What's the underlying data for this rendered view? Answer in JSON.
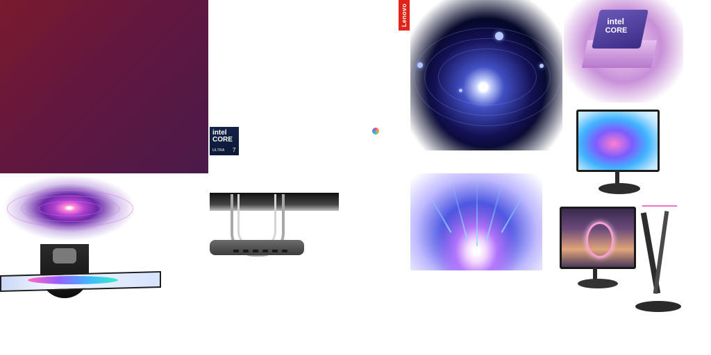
{
  "brand": {
    "logo_text": "Lenovo",
    "accent": "#e2231a"
  },
  "badges": {
    "intel": {
      "line1": "intel",
      "line2": "CORE",
      "line3": "ULTRA",
      "line4": "7"
    },
    "chip": {
      "line1": "intel",
      "line2": "CORE"
    }
  },
  "colors": {
    "hero_gradient": [
      "#7a1a2e",
      "#4a1a4a"
    ],
    "galaxy": "#0b0a40",
    "burst": "#4b56e0"
  },
  "icons": [
    "copilot-icon"
  ]
}
